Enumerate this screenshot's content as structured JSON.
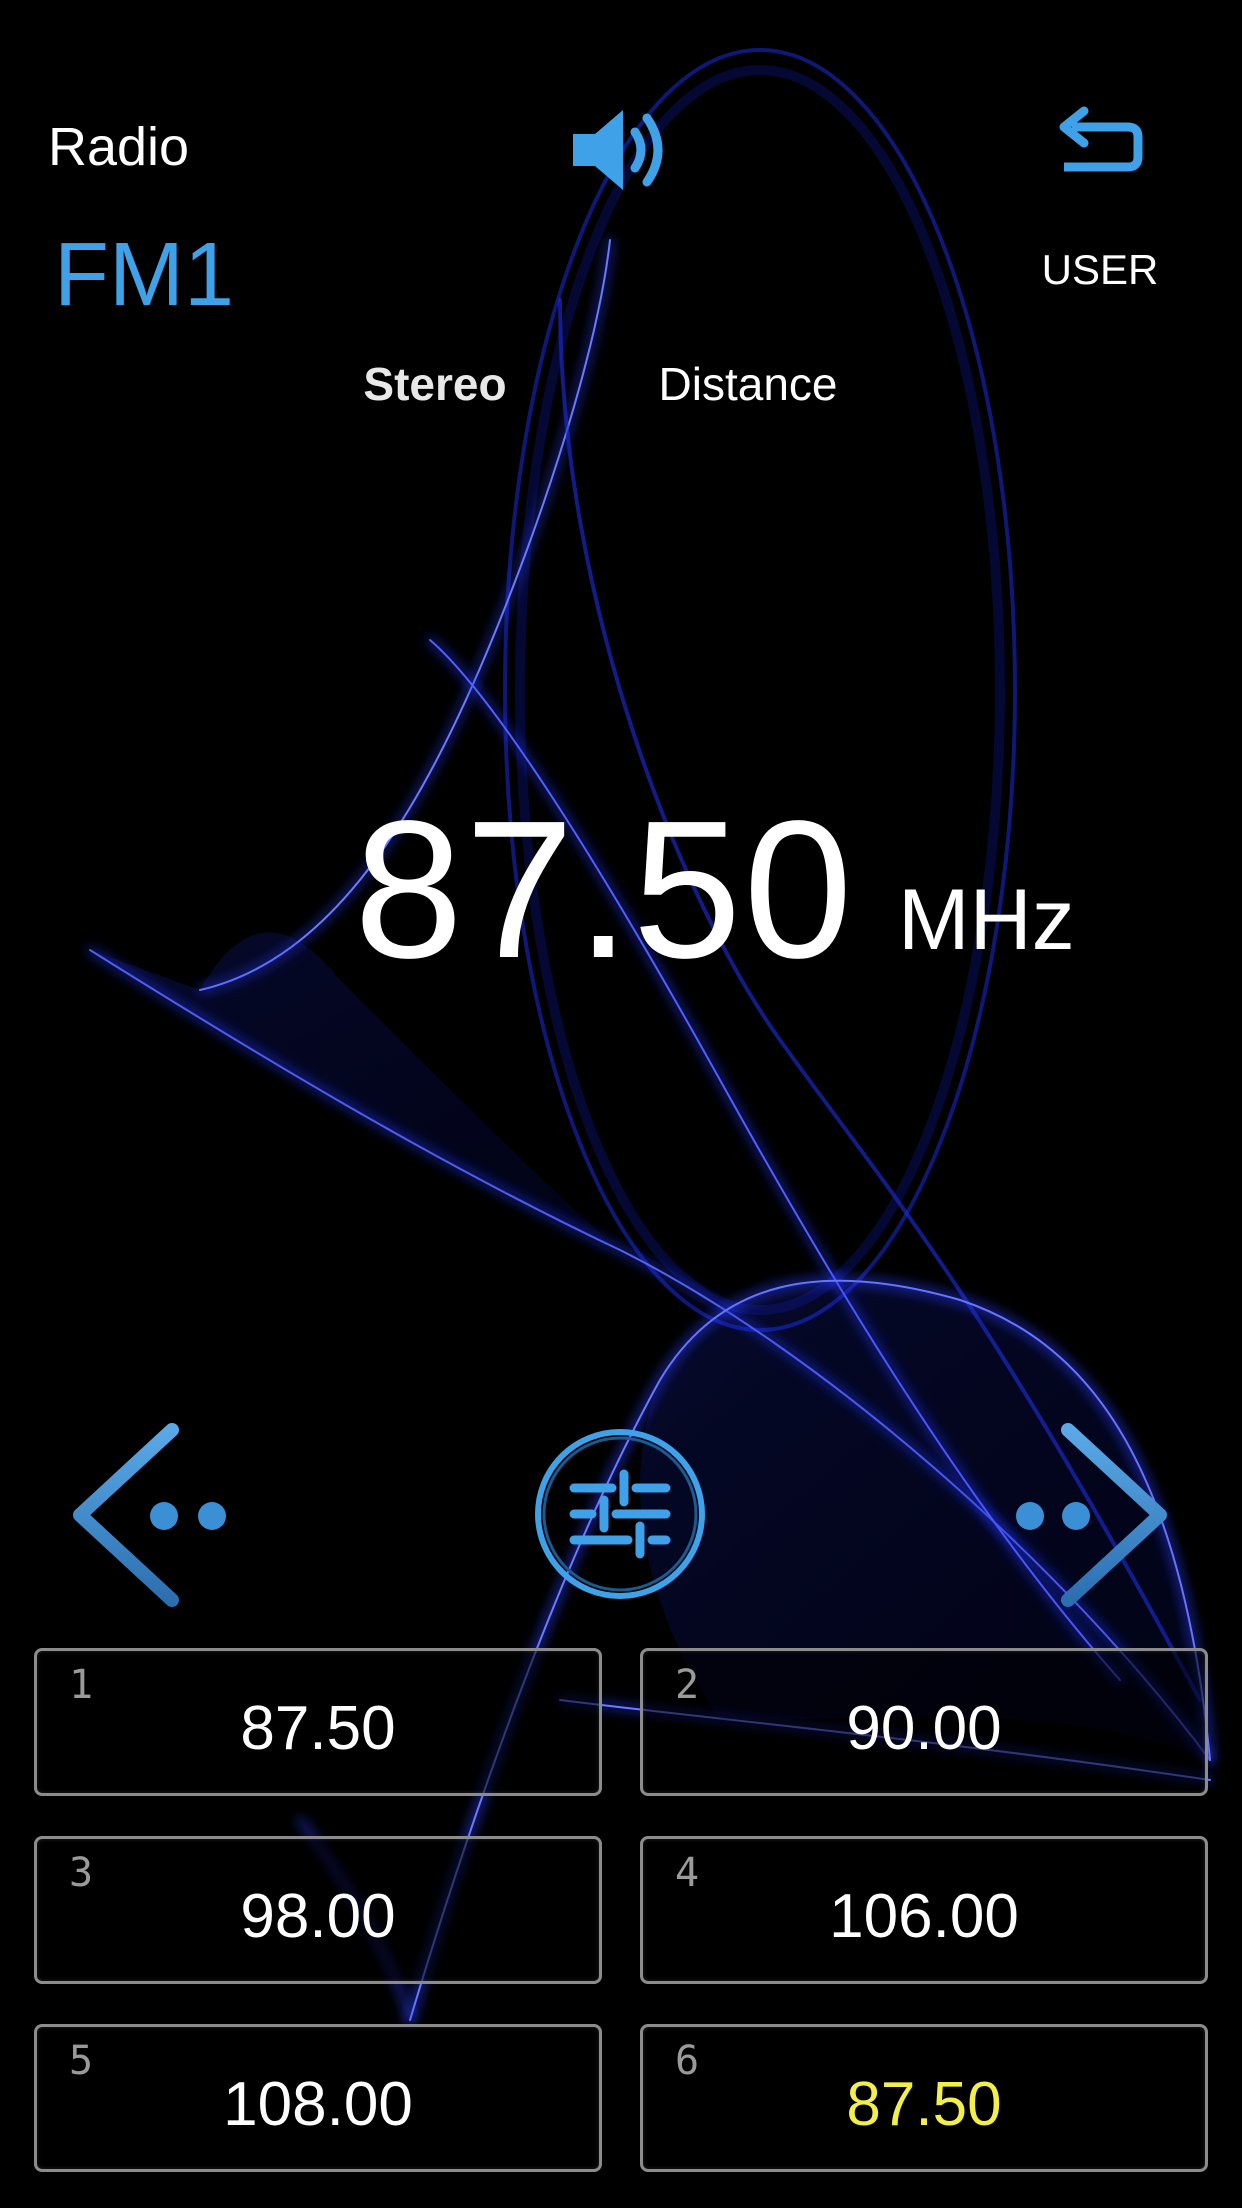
{
  "header": {
    "app_title": "Radio",
    "band": "FM1",
    "user_label": "USER",
    "stereo_label": "Stereo",
    "distance_label": "Distance",
    "volume_icon": "speaker-volume-icon",
    "back_icon": "return-arrow-icon"
  },
  "tuner": {
    "frequency": "87.50",
    "unit": "MHz"
  },
  "controls": {
    "prev_icon": "seek-previous-icon",
    "next_icon": "seek-next-icon",
    "eq_icon": "equalizer-sliders-icon"
  },
  "presets": [
    {
      "number": "1",
      "frequency": "87.50",
      "active": false
    },
    {
      "number": "2",
      "frequency": "90.00",
      "active": false
    },
    {
      "number": "3",
      "frequency": "98.00",
      "active": false
    },
    {
      "number": "4",
      "frequency": "106.00",
      "active": false
    },
    {
      "number": "5",
      "frequency": "108.00",
      "active": false
    },
    {
      "number": "6",
      "frequency": "87.50",
      "active": true
    }
  ],
  "colors": {
    "accent_blue": "#3fa2e8",
    "active_preset": "#f2ef4b",
    "background": "#000000",
    "wallpaper_wave": "#1a2cff"
  }
}
